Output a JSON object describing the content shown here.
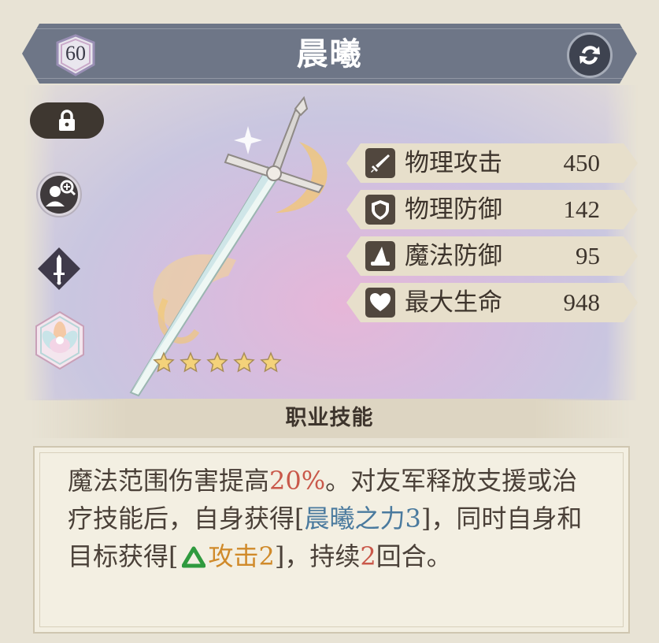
{
  "header": {
    "level": "60",
    "title": "晨曦"
  },
  "rarity": {
    "stars": 5,
    "max": 5
  },
  "side_icons": [
    "lock-icon",
    "magnify-character-icon",
    "sword-class-icon",
    "lotus-emblem-icon"
  ],
  "stats": [
    {
      "icon": "sword-icon",
      "label": "物理攻击",
      "value": "450"
    },
    {
      "icon": "shield-icon",
      "label": "物理防御",
      "value": "142"
    },
    {
      "icon": "wizard-hat-icon",
      "label": "魔法防御",
      "value": "95"
    },
    {
      "icon": "heart-icon",
      "label": "最大生命",
      "value": "948"
    }
  ],
  "skill": {
    "title": "职业技能",
    "desc": {
      "p1": "魔法范围伤害提高",
      "pct": "20%",
      "p2": "。对友军释放支援或治疗技能后，自身获得[",
      "buff": "晨曦之力3",
      "p3": "]，同时自身和目标获得[",
      "atk": "攻击2",
      "p4": "]，持续",
      "turns": "2",
      "p5": "回合。"
    }
  },
  "colors": {
    "header_bg": "#6e7687",
    "highlight_red": "#c9584a",
    "highlight_blue": "#4a7a9e",
    "highlight_orange": "#d08a2a",
    "buff_green": "#2f9a3e"
  }
}
